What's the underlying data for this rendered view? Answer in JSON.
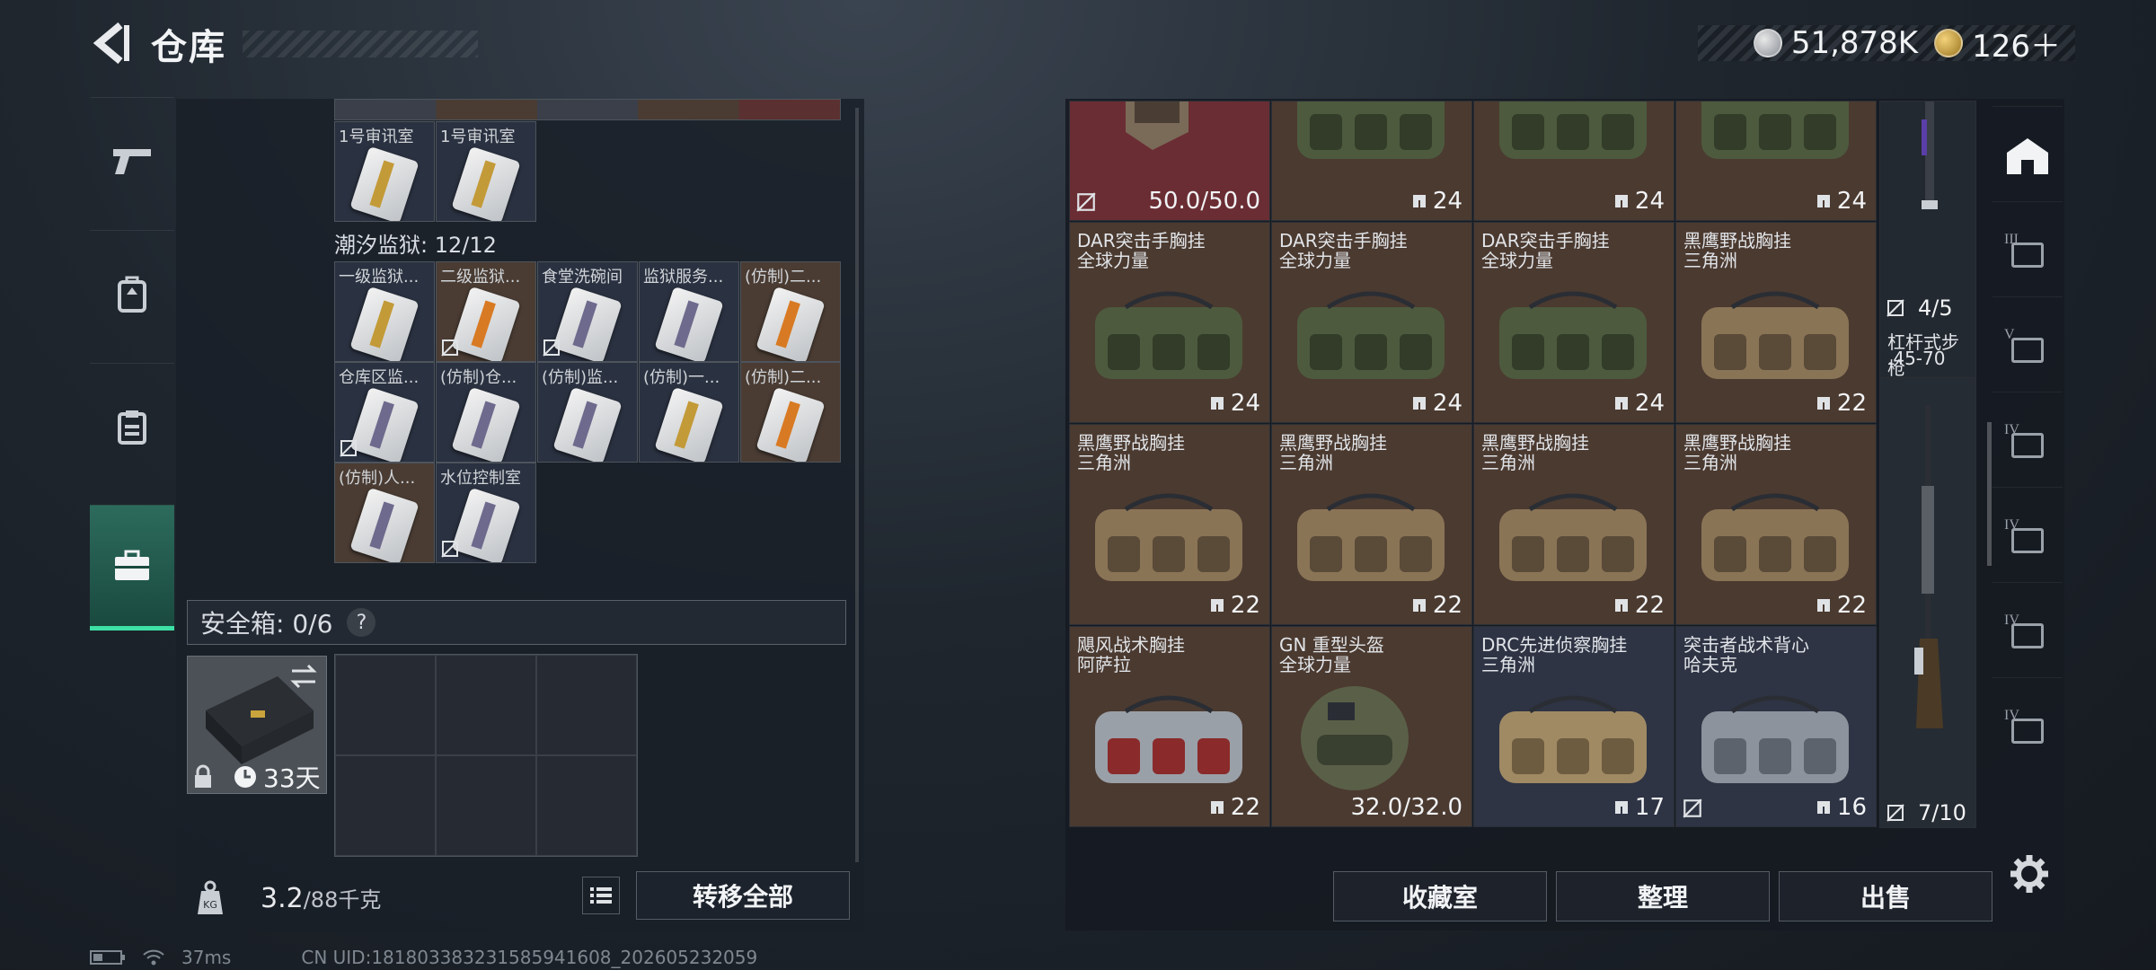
{
  "header": {
    "title": "仓库",
    "currency": [
      {
        "icon": "silver-coin-icon",
        "value": "51,878K"
      },
      {
        "icon": "gold-coin-icon",
        "value": "126＋"
      }
    ]
  },
  "left_panel": {
    "top_row": [
      {
        "name": "1号审讯室",
        "card": "gold"
      },
      {
        "name": "1号审讯室",
        "card": "gold"
      }
    ],
    "section_title": "潮汐监狱: 12/12",
    "cells": [
      {
        "name": "一级监狱...",
        "card": "gold",
        "nofav": false,
        "bg": "blue"
      },
      {
        "name": "二级监狱...",
        "card": "orange",
        "nofav": true,
        "bg": "brown"
      },
      {
        "name": "食堂洗碗间",
        "card": "purple",
        "nofav": true,
        "bg": "blue"
      },
      {
        "name": "监狱服务...",
        "card": "purple",
        "nofav": false,
        "bg": "blue"
      },
      {
        "name": "(仿制)二...",
        "card": "orange",
        "nofav": false,
        "bg": "brown"
      },
      {
        "name": "仓库区监...",
        "card": "purple",
        "nofav": true,
        "bg": "blue"
      },
      {
        "name": "(仿制)仓...",
        "card": "purple",
        "nofav": false,
        "bg": "blue"
      },
      {
        "name": "(仿制)监...",
        "card": "purple",
        "nofav": false,
        "bg": "blue"
      },
      {
        "name": "(仿制)一...",
        "card": "gold",
        "nofav": false,
        "bg": "blue"
      },
      {
        "name": "(仿制)二...",
        "card": "orange",
        "nofav": false,
        "bg": "brown"
      },
      {
        "name": "(仿制)人...",
        "card": "purple",
        "nofav": false,
        "bg": "brown"
      },
      {
        "name": "水位控制室",
        "card": "purple",
        "nofav": true,
        "bg": "blue"
      }
    ],
    "safe_box_label": "安全箱: 0/6",
    "help": "?",
    "safe_case_timer": "33天",
    "weight_value": "3.2",
    "weight_max": "/88千克",
    "transfer_all": "转移全部"
  },
  "right_panel": {
    "top_row": [
      {
        "qty": "50.0/50.0",
        "bg": "red",
        "type": "plate",
        "nofav": true
      },
      {
        "qty": "24",
        "bg": "brown",
        "type": "bag-green",
        "nofav": false
      },
      {
        "qty": "24",
        "bg": "brown",
        "type": "bag-green",
        "nofav": false
      },
      {
        "qty": "24",
        "bg": "brown",
        "type": "bag-green",
        "nofav": false
      }
    ],
    "items": [
      {
        "name": "DAR突击手胸挂",
        "sub": "全球力量",
        "qty": "24",
        "bg": "brown",
        "color": "green"
      },
      {
        "name": "DAR突击手胸挂",
        "sub": "全球力量",
        "qty": "24",
        "bg": "brown",
        "color": "green"
      },
      {
        "name": "DAR突击手胸挂",
        "sub": "全球力量",
        "qty": "24",
        "bg": "brown",
        "color": "green"
      },
      {
        "name": "黑鹰野战胸挂",
        "sub": "三角洲",
        "qty": "22",
        "bg": "brown",
        "color": "tan"
      },
      {
        "name": "黑鹰野战胸挂",
        "sub": "三角洲",
        "qty": "22",
        "bg": "brown",
        "color": "tan"
      },
      {
        "name": "黑鹰野战胸挂",
        "sub": "三角洲",
        "qty": "22",
        "bg": "brown",
        "color": "tan"
      },
      {
        "name": "黑鹰野战胸挂",
        "sub": "三角洲",
        "qty": "22",
        "bg": "brown",
        "color": "tan"
      },
      {
        "name": "黑鹰野战胸挂",
        "sub": "三角洲",
        "qty": "22",
        "bg": "brown",
        "color": "tan"
      },
      {
        "name": "飓风战术胸挂",
        "sub": "阿萨拉",
        "qty": "22",
        "bg": "brown",
        "color": "grey-red"
      },
      {
        "name": "GN 重型头盔",
        "sub": "全球力量",
        "qty": "32.0/32.0",
        "bg": "brown",
        "color": "helmet"
      },
      {
        "name": "DRC先进侦察胸挂",
        "sub": "三角洲",
        "qty": "17",
        "bg": "blue",
        "color": "khaki"
      },
      {
        "name": "突击者战术背心",
        "sub": "哈夫克",
        "qty": "16",
        "bg": "blue",
        "color": "grey"
      }
    ],
    "weapon_1": {
      "count": "4/5",
      "name": "杠杆式步枪",
      "sub": ".45-70"
    },
    "weapon_2": {
      "count": "7/10"
    },
    "buttons": {
      "collection": "收藏室",
      "organize": "整理",
      "sell": "出售"
    },
    "side_icons": [
      {
        "icon": "safehouse-icon",
        "label": ""
      },
      {
        "icon": "category-3-icon",
        "label": "III"
      },
      {
        "icon": "category-5-icon",
        "label": "V"
      },
      {
        "icon": "category-4-icon",
        "label": "IV"
      },
      {
        "icon": "category-4-plus-icon",
        "label": "IV"
      },
      {
        "icon": "category-4-plus-icon",
        "label": "IV"
      },
      {
        "icon": "category-4-warn-icon",
        "label": "IV"
      }
    ]
  },
  "status_bar": {
    "ping": "37ms",
    "uid": "CN UID:18180338323158594160​8_202605232059"
  }
}
